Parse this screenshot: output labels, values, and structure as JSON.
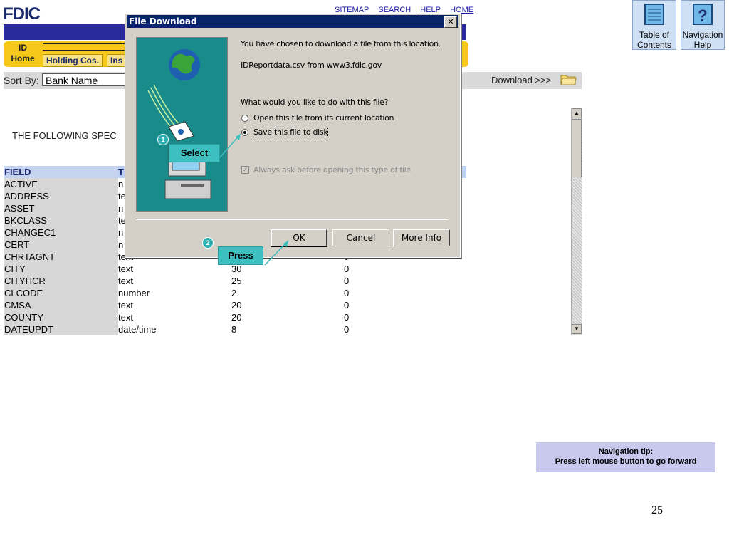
{
  "site": {
    "logo": "FDIC",
    "top_links": [
      "SITEMAP",
      "SEARCH",
      "HELP",
      "HOME"
    ],
    "tabs": {
      "home_line1": "ID",
      "home_line2": "Home",
      "holding": "Holding Cos.",
      "ins": "Ins"
    },
    "sort_label": "Sort By:",
    "sort_value": "Bank Name",
    "download_label": "Download >>>",
    "following_text": "THE FOLLOWING SPEC",
    "table": {
      "header": [
        "FIELD",
        "T",
        "",
        ""
      ],
      "rows": [
        [
          "ACTIVE",
          "n",
          "",
          ""
        ],
        [
          "ADDRESS",
          "te",
          "",
          ""
        ],
        [
          "ASSET",
          "n",
          "",
          ""
        ],
        [
          "BKCLASS",
          "te",
          "",
          ""
        ],
        [
          "CHANGEC1",
          "n",
          "",
          ""
        ],
        [
          "CERT",
          "n",
          "",
          ""
        ],
        [
          "CHRTAGNT",
          "text",
          "",
          "0"
        ],
        [
          "CITY",
          "text",
          "30",
          "0"
        ],
        [
          "CITYHCR",
          "text",
          "25",
          "0"
        ],
        [
          "CLCODE",
          "number",
          "2",
          "0"
        ],
        [
          "CMSA",
          "text",
          "20",
          "0"
        ],
        [
          "COUNTY",
          "text",
          "20",
          "0"
        ],
        [
          "DATEUPDT",
          "date/time",
          "8",
          "0"
        ]
      ]
    }
  },
  "nav_buttons": {
    "toc_line1": "Table of",
    "toc_line2": "Contents",
    "help_line1": "Navigation",
    "help_line2": "Help"
  },
  "dialog": {
    "title": "File Download",
    "close": "✕",
    "line1": "You have chosen to download a file from this location.",
    "line2": "IDReportdata.csv from www3.fdic.gov",
    "question": "What would you like to do with this file?",
    "option_open": "Open this file from its current location",
    "option_save": "Save this file to disk",
    "always_ask": "Always ask before opening this type of file",
    "ok": "OK",
    "cancel": "Cancel",
    "more_info": "More Info"
  },
  "callouts": {
    "step1_num": "1",
    "step1_label": "Select",
    "step2_num": "2",
    "step2_label": "Press"
  },
  "tip": {
    "line1": "Navigation tip:",
    "line2": "Press left mouse button to go forward"
  },
  "page_number": "25",
  "colors": {
    "fdic_blue": "#2b2a9c",
    "tab_gold": "#f7c81c",
    "callout_teal": "#3dbfc0",
    "titlebar": "#0a246a"
  }
}
